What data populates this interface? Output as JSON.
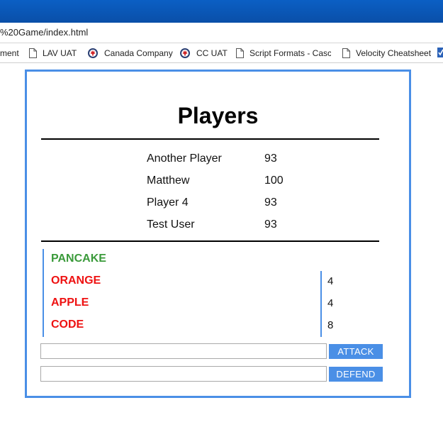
{
  "browser": {
    "url": "%20Game/index.html",
    "bookmarks": [
      {
        "label": "ment",
        "icon": "none"
      },
      {
        "label": "LAV UAT",
        "icon": "page-icon"
      },
      {
        "label": "Canada Company",
        "icon": "maple-seal-icon"
      },
      {
        "label": "CC UAT",
        "icon": "maple-seal-icon"
      },
      {
        "label": "Script Formats - Casc",
        "icon": "page-icon"
      },
      {
        "label": "Velocity Cheatsheet",
        "icon": "page-icon"
      }
    ]
  },
  "game": {
    "title": "Players",
    "players": [
      {
        "name": "Another Player",
        "score": "93"
      },
      {
        "name": "Matthew",
        "score": "100"
      },
      {
        "name": "Player 4",
        "score": "93"
      },
      {
        "name": "Test User",
        "score": "93"
      }
    ],
    "words": [
      {
        "text": "PANCAKE",
        "color": "#3a9a3a",
        "count": ""
      },
      {
        "text": "ORANGE",
        "color": "#ee1111",
        "count": "4"
      },
      {
        "text": "APPLE",
        "color": "#ee1111",
        "count": "4"
      },
      {
        "text": "CODE",
        "color": "#ee1111",
        "count": "8"
      }
    ],
    "attack_input": {
      "value": "",
      "placeholder": ""
    },
    "defend_input": {
      "value": "",
      "placeholder": ""
    },
    "attack_label": "ATTACK",
    "defend_label": "DEFEND"
  },
  "colors": {
    "accent": "#4a8fe6",
    "titlebar": "#0b5fc4",
    "positive_word": "#3a9a3a",
    "negative_word": "#ee1111"
  }
}
